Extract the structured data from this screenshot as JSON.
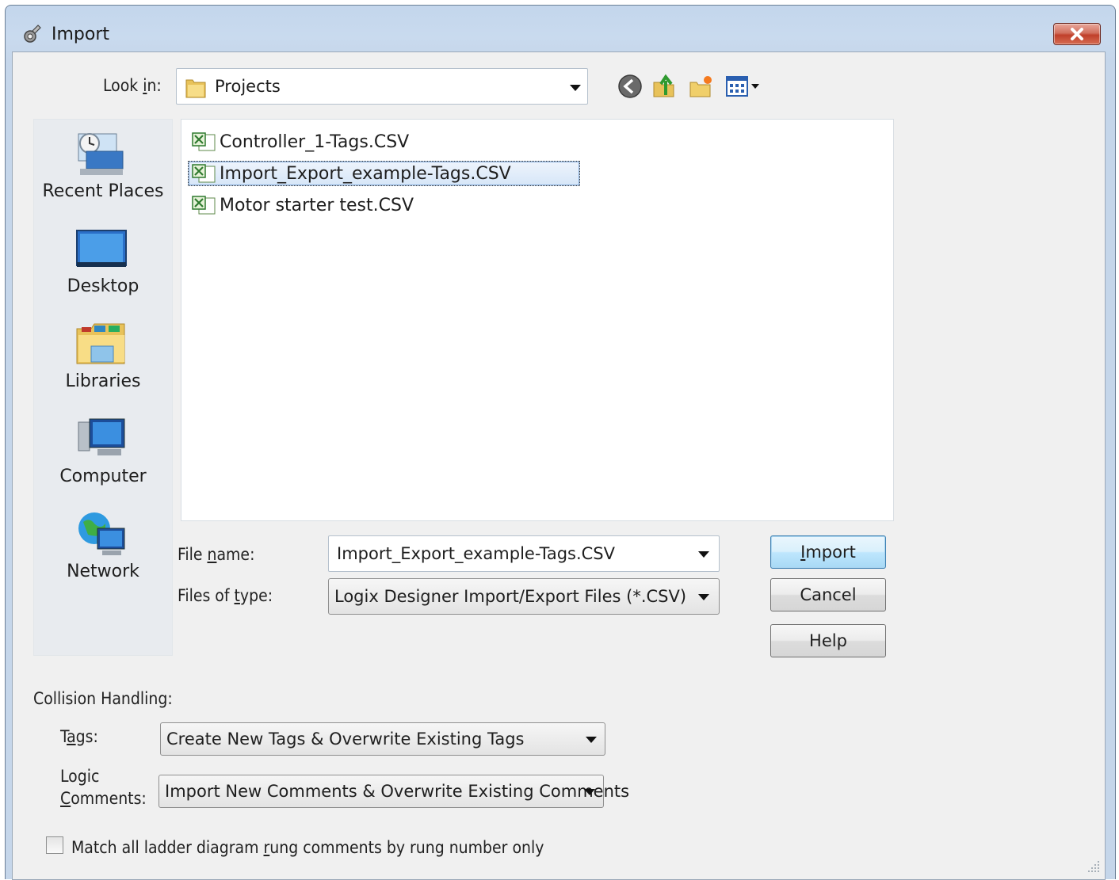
{
  "window": {
    "title": "Import",
    "close_icon": "close-icon"
  },
  "lookin": {
    "label": "Look in:",
    "value": "Projects",
    "icon": "folder-icon"
  },
  "toolbar": {
    "icons": [
      "back-icon",
      "up-folder-icon",
      "new-folder-icon",
      "view-menu-icon"
    ]
  },
  "places": [
    {
      "label": "Recent Places",
      "icon": "recent-places-icon"
    },
    {
      "label": "Desktop",
      "icon": "desktop-icon"
    },
    {
      "label": "Libraries",
      "icon": "libraries-icon"
    },
    {
      "label": "Computer",
      "icon": "computer-icon"
    },
    {
      "label": "Network",
      "icon": "network-icon"
    }
  ],
  "files": [
    {
      "name": "Controller_1-Tags.CSV",
      "selected": false
    },
    {
      "name": "Import_Export_example-Tags.CSV",
      "selected": true
    },
    {
      "name": "Motor starter test.CSV",
      "selected": false
    }
  ],
  "filename": {
    "label": "File name:",
    "value": "Import_Export_example-Tags.CSV"
  },
  "filetype": {
    "label": "Files of type:",
    "value": "Logix Designer Import/Export Files (*.CSV)"
  },
  "buttons": {
    "import": "Import",
    "cancel": "Cancel",
    "help": "Help"
  },
  "collision": {
    "heading": "Collision Handling:",
    "tags_label": "Tags:",
    "tags_value": "Create New Tags & Overwrite Existing Tags",
    "logic_label_1": "Logic",
    "logic_label_2": "Comments:",
    "logic_value": "Import New Comments & Overwrite Existing Comments"
  },
  "match_checkbox": {
    "label": "Match all ladder diagram rung comments by rung number only",
    "checked": false
  }
}
